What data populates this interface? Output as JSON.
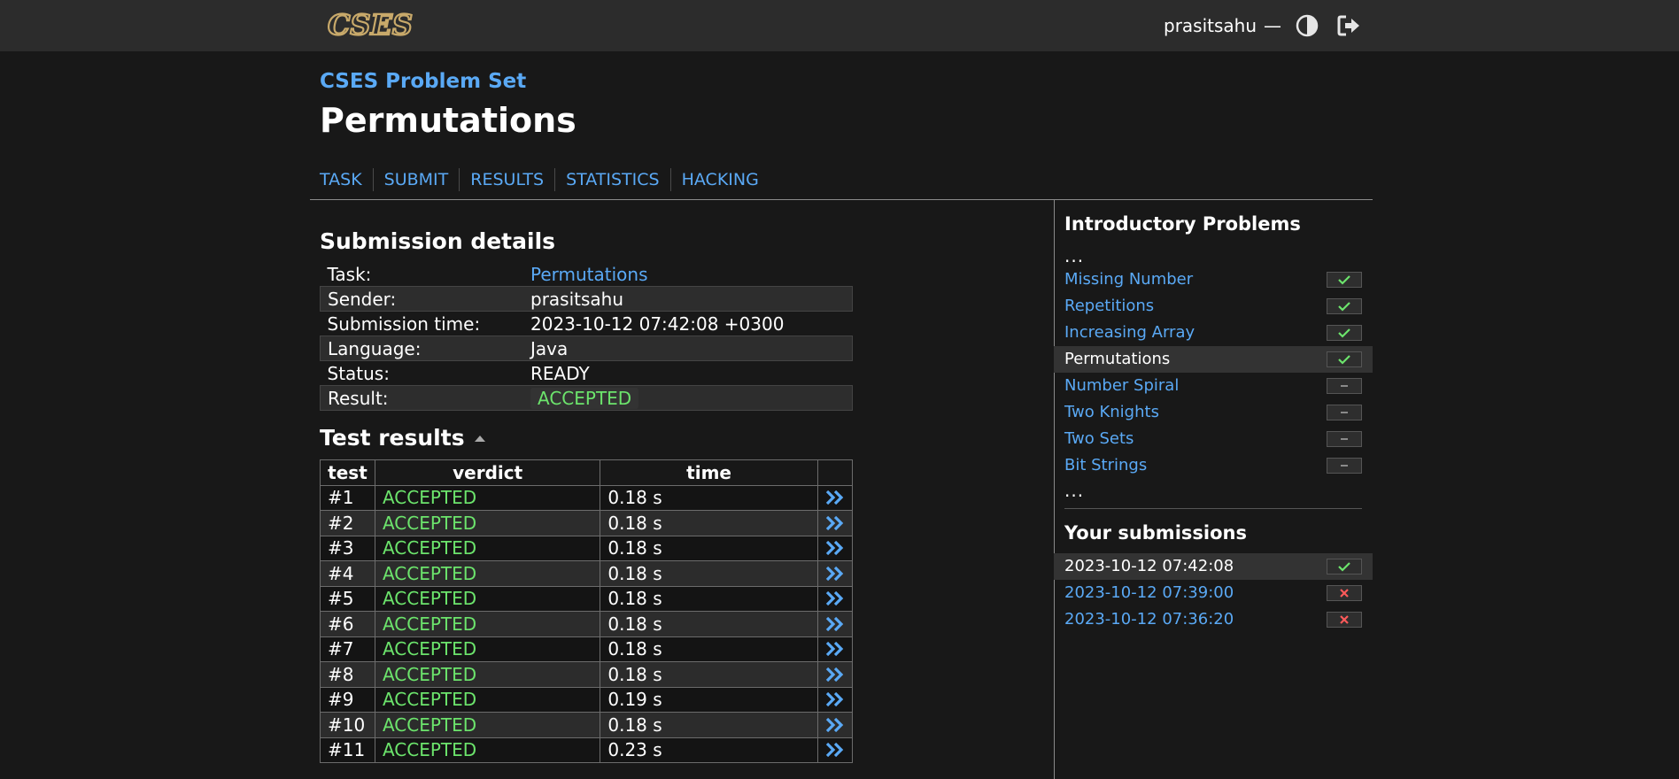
{
  "header": {
    "logo_text": "CSES",
    "username": "prasitsahu",
    "separator": "—",
    "contrast_icon": "contrast-icon",
    "logout_icon": "logout-icon"
  },
  "site_title": "CSES Problem Set",
  "page_title": "Permutations",
  "nav": [
    "TASK",
    "SUBMIT",
    "RESULTS",
    "STATISTICS",
    "HACKING"
  ],
  "submission": {
    "heading": "Submission details",
    "rows": [
      {
        "label": "Task:",
        "value": "Permutations"
      },
      {
        "label": "Sender:",
        "value": "prasitsahu"
      },
      {
        "label": "Submission time:",
        "value": "2023-10-12 07:42:08 +0300"
      },
      {
        "label": "Language:",
        "value": "Java"
      },
      {
        "label": "Status:",
        "value": "READY"
      },
      {
        "label": "Result:",
        "value": "ACCEPTED"
      }
    ]
  },
  "tests": {
    "heading": "Test results",
    "headers": [
      "test",
      "verdict",
      "time"
    ],
    "rows": [
      {
        "test": "#1",
        "verdict": "ACCEPTED",
        "time": "0.18 s"
      },
      {
        "test": "#2",
        "verdict": "ACCEPTED",
        "time": "0.18 s"
      },
      {
        "test": "#3",
        "verdict": "ACCEPTED",
        "time": "0.18 s"
      },
      {
        "test": "#4",
        "verdict": "ACCEPTED",
        "time": "0.18 s"
      },
      {
        "test": "#5",
        "verdict": "ACCEPTED",
        "time": "0.18 s"
      },
      {
        "test": "#6",
        "verdict": "ACCEPTED",
        "time": "0.18 s"
      },
      {
        "test": "#7",
        "verdict": "ACCEPTED",
        "time": "0.18 s"
      },
      {
        "test": "#8",
        "verdict": "ACCEPTED",
        "time": "0.18 s"
      },
      {
        "test": "#9",
        "verdict": "ACCEPTED",
        "time": "0.19 s"
      },
      {
        "test": "#10",
        "verdict": "ACCEPTED",
        "time": "0.18 s"
      },
      {
        "test": "#11",
        "verdict": "ACCEPTED",
        "time": "0.23 s"
      }
    ]
  },
  "sidebar": {
    "section_title": "Introductory Problems",
    "ellipsis": "...",
    "problems": [
      {
        "name": "Missing Number",
        "status": "solved",
        "active": false
      },
      {
        "name": "Repetitions",
        "status": "solved",
        "active": false
      },
      {
        "name": "Increasing Array",
        "status": "solved",
        "active": false
      },
      {
        "name": "Permutations",
        "status": "solved",
        "active": true
      },
      {
        "name": "Number Spiral",
        "status": "none",
        "active": false
      },
      {
        "name": "Two Knights",
        "status": "none",
        "active": false
      },
      {
        "name": "Two Sets",
        "status": "none",
        "active": false
      },
      {
        "name": "Bit Strings",
        "status": "none",
        "active": false
      }
    ],
    "submissions_title": "Your submissions",
    "submissions": [
      {
        "time": "2023-10-12 07:42:08",
        "status": "accepted",
        "active": true
      },
      {
        "time": "2023-10-12 07:39:00",
        "status": "rejected",
        "active": false
      },
      {
        "time": "2023-10-12 07:36:20",
        "status": "rejected",
        "active": false
      }
    ]
  },
  "colors": {
    "accent": "#5aa9f5",
    "accepted": "#6ce46c",
    "rejected": "#ff5a5a",
    "logo": "#c8a96a"
  }
}
